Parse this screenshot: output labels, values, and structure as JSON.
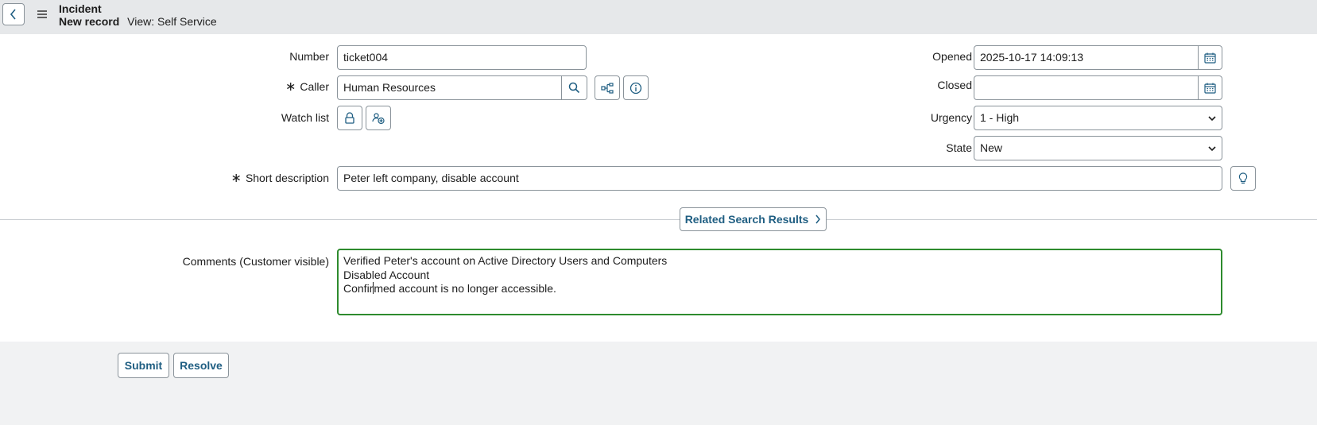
{
  "header": {
    "title": "Incident",
    "record": "New record",
    "view": "View: Self Service"
  },
  "form": {
    "number": {
      "label": "Number",
      "value": "ticket004"
    },
    "caller": {
      "label": "Caller",
      "value": "Human Resources",
      "required_mark": "∗"
    },
    "watch_list": {
      "label": "Watch list"
    },
    "short_description": {
      "label": "Short description",
      "value": "Peter left company, disable account",
      "required_mark": "∗"
    },
    "opened": {
      "label": "Opened",
      "value": "2025-10-17 14:09:13"
    },
    "closed": {
      "label": "Closed",
      "value": ""
    },
    "urgency": {
      "label": "Urgency",
      "value": "1 - High"
    },
    "state": {
      "label": "State",
      "value": "New"
    },
    "related_search": {
      "label": "Related Search Results"
    },
    "comments": {
      "label": "Comments (Customer visible)",
      "line1": "Verified Peter's account on Active Directory Users and Computers",
      "line2": "Disabled Account",
      "line3_before_cursor": "Confir",
      "line3_after_cursor": "med account is no longer accessible."
    }
  },
  "actions": {
    "submit": "Submit",
    "resolve": "Resolve"
  },
  "icons": {
    "back": "chevron-left-icon",
    "menu": "hamburger-icon",
    "search": "search-icon",
    "hierarchy": "hierarchy-icon",
    "info": "info-icon",
    "lock": "lock-icon",
    "add_user": "add-user-icon",
    "calendar": "calendar-icon",
    "lightbulb": "lightbulb-icon"
  },
  "colors": {
    "header_bg": "#e6e8ea",
    "accent_text": "#1f5e82",
    "focus_border": "#2e8b2e",
    "footer_bg": "#f1f2f3"
  }
}
